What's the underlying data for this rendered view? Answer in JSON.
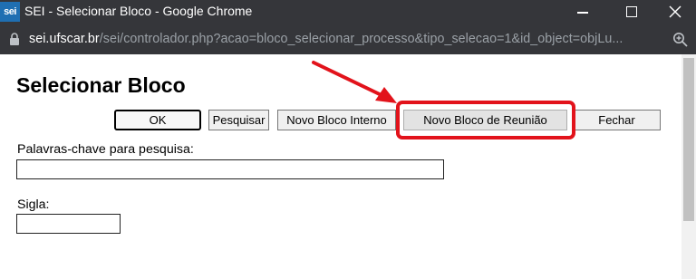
{
  "window": {
    "logo_text": "sei",
    "title": "SEI - Selecionar Bloco - Google Chrome"
  },
  "addressbar": {
    "url_host": "sei.ufscar.br",
    "url_path": "/sei/controlador.php?acao=bloco_selecionar_processo&tipo_selecao=1&id_object=objLu...",
    "icons": [
      "lock-icon",
      "zoom-icon"
    ]
  },
  "page": {
    "title": "Selecionar Bloco",
    "buttons": {
      "ok": "OK",
      "pesquisar": "Pesquisar",
      "novo_interno": "Novo Bloco Interno",
      "novo_reuniao": "Novo Bloco de Reunião",
      "fechar": "Fechar"
    },
    "fields": {
      "keywords_label": "Palavras-chave para pesquisa:",
      "keywords_value": "",
      "sigla_label": "Sigla:",
      "sigla_value": ""
    },
    "annotation_color": "#e2131b"
  }
}
